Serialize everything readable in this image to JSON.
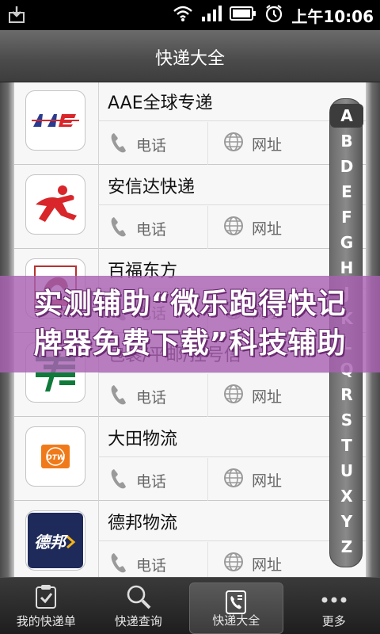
{
  "status_bar": {
    "time": "上午10:06"
  },
  "header": {
    "title": "快递大全"
  },
  "couriers": [
    {
      "name": "AAE全球专递",
      "logo": "aae-logo",
      "phone_label": "电话",
      "web_label": "网址"
    },
    {
      "name": "安信达快递",
      "logo": "anxinda-logo",
      "phone_label": "电话",
      "web_label": "网址"
    },
    {
      "name": "百福东方",
      "logo": "baifu-logo",
      "phone_label": "电话",
      "web_label": "网址"
    },
    {
      "name": "包裹/平邮/挂号信",
      "logo": "china-post-logo",
      "phone_label": "电话",
      "web_label": "网址"
    },
    {
      "name": "大田物流",
      "logo": "dtw-logo",
      "logo_text": "DTW",
      "phone_label": "电话",
      "web_label": "网址"
    },
    {
      "name": "德邦物流",
      "logo": "debang-logo",
      "logo_text": "德邦",
      "phone_label": "电话",
      "web_label": "网址"
    }
  ],
  "alphabet_index": [
    "A",
    "B",
    "D",
    "E",
    "F",
    "G",
    "H",
    "J",
    "K",
    "L",
    "Q",
    "R",
    "S",
    "T",
    "U",
    "X",
    "Y",
    "Z"
  ],
  "alphabet_active": "A",
  "watermark": {
    "line1": "实测辅助“微乐跑得快记",
    "line2": "牌器免费下载”科技辅助"
  },
  "bottom_nav": [
    {
      "label": "我的快递单",
      "icon": "clipboard-check-icon",
      "active": false
    },
    {
      "label": "快递查询",
      "icon": "magnifier-icon",
      "active": false
    },
    {
      "label": "快递大全",
      "icon": "phone-book-icon",
      "active": true
    },
    {
      "label": "更多",
      "icon": "more-dots-icon",
      "active": false
    }
  ],
  "colors": {
    "accent_red": "#d8262a",
    "china_post_green": "#0f7a3a",
    "dtw_orange": "#f07a1a",
    "debang_navy": "#1d2a5a",
    "banner_purple": "#a862b2"
  }
}
